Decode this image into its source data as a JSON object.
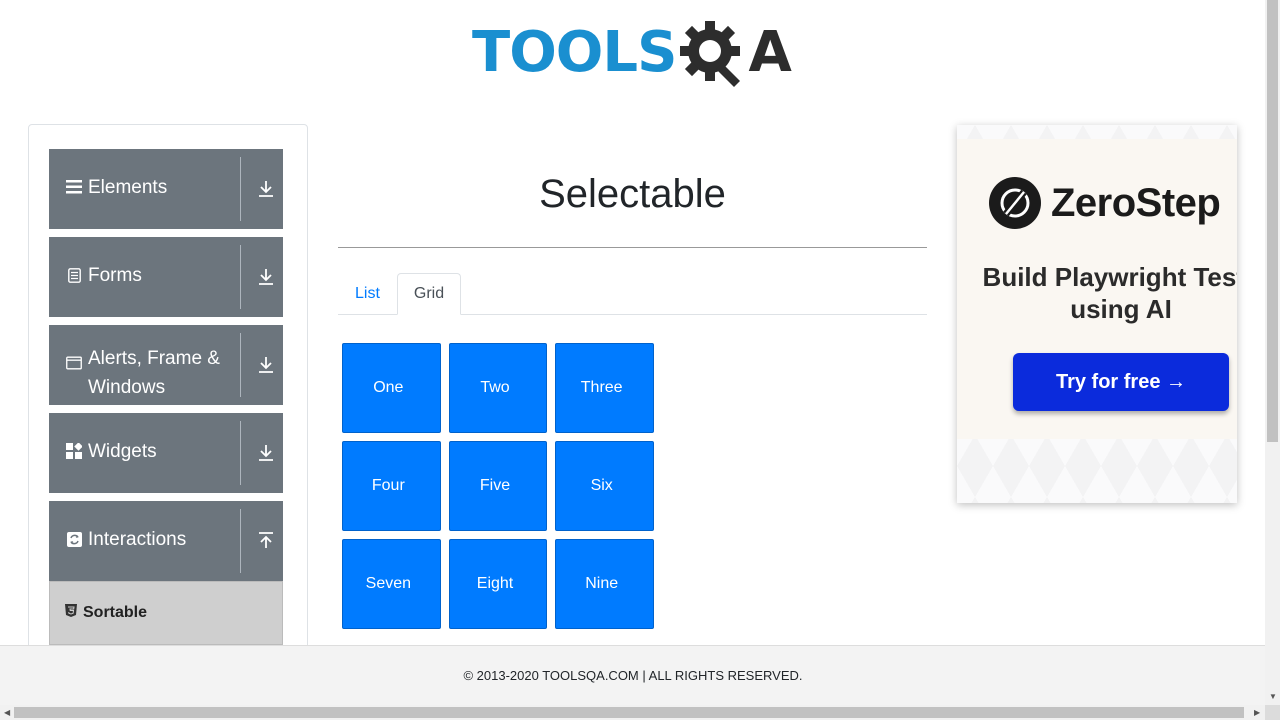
{
  "header": {
    "logo_text_left": "TOOLS",
    "logo_text_right": "A",
    "logo_alt": "TOOLSQA"
  },
  "sidebar": {
    "groups": [
      {
        "label": "Elements",
        "icon": "hamburger-icon",
        "state": "collapsed"
      },
      {
        "label": "Forms",
        "icon": "document-icon",
        "state": "collapsed"
      },
      {
        "label": "Alerts, Frame & Windows",
        "icon": "window-icon",
        "state": "collapsed"
      },
      {
        "label": "Widgets",
        "icon": "widgets-icon",
        "state": "collapsed"
      },
      {
        "label": "Interactions",
        "icon": "interactions-icon",
        "state": "expanded"
      }
    ],
    "items": [
      {
        "label": "Sortable",
        "icon": "html5-icon"
      }
    ]
  },
  "main": {
    "title": "Selectable",
    "tabs": [
      {
        "label": "List",
        "active": false
      },
      {
        "label": "Grid",
        "active": true
      }
    ],
    "grid": [
      [
        "One",
        "Two",
        "Three"
      ],
      [
        "Four",
        "Five",
        "Six"
      ],
      [
        "Seven",
        "Eight",
        "Nine"
      ]
    ]
  },
  "ad": {
    "brand": "ZeroStep",
    "tagline": "Build Playwright Tests using AI",
    "cta": "Try for free →"
  },
  "footer": {
    "text": "© 2013-2020 TOOLSQA.COM | ALL RIGHTS RESERVED."
  },
  "colors": {
    "primary": "#007bff",
    "sidebar_group": "#6c757d",
    "logo_blue": "#1a8fd0",
    "ad_cta": "#0b2bdc"
  }
}
